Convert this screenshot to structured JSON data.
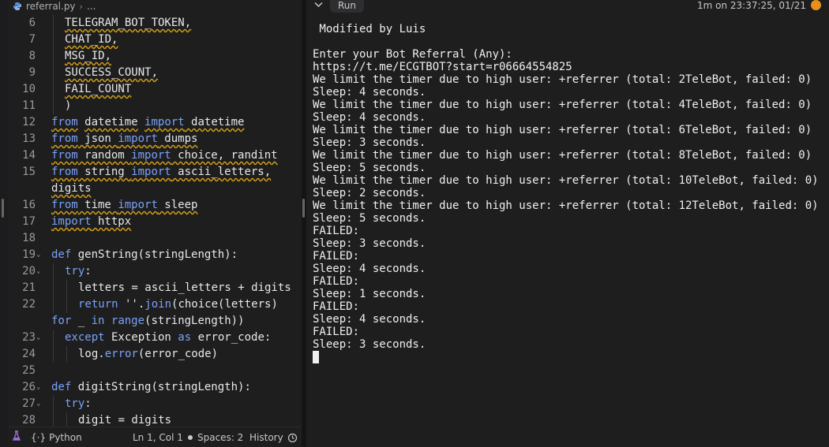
{
  "editor": {
    "filename": "referral.py",
    "breadcrumb_more": "...",
    "lines": [
      {
        "n": "6",
        "indent": 1,
        "segments": [
          {
            "t": "TELEGRAM_BOT_TOKEN,",
            "c": "sq"
          }
        ]
      },
      {
        "n": "7",
        "indent": 1,
        "segments": [
          {
            "t": "CHAT_ID,",
            "c": "sq"
          }
        ]
      },
      {
        "n": "8",
        "indent": 1,
        "segments": [
          {
            "t": "MSG_ID,",
            "c": "sq"
          }
        ]
      },
      {
        "n": "9",
        "indent": 1,
        "segments": [
          {
            "t": "SUCCESS_COUNT,",
            "c": "sq"
          }
        ]
      },
      {
        "n": "10",
        "indent": 1,
        "segments": [
          {
            "t": "FAIL_COUNT",
            "c": "sq"
          }
        ]
      },
      {
        "n": "11",
        "indent": 1,
        "segments": [
          {
            "t": ")",
            "c": ""
          }
        ]
      },
      {
        "n": "12",
        "indent": 0,
        "segments": [
          {
            "t": "from",
            "c": "kw sq"
          },
          {
            "t": " ",
            "c": ""
          },
          {
            "t": "datetime",
            "c": "sq"
          },
          {
            "t": " ",
            "c": ""
          },
          {
            "t": "import",
            "c": "kw sq"
          },
          {
            "t": " datetime",
            "c": "sq"
          }
        ]
      },
      {
        "n": "13",
        "indent": 0,
        "segments": [
          {
            "t": "from",
            "c": "kw sq"
          },
          {
            "t": " json ",
            "c": "sq"
          },
          {
            "t": "import",
            "c": "kw sq"
          },
          {
            "t": " dumps",
            "c": "sq"
          }
        ]
      },
      {
        "n": "14",
        "indent": 0,
        "segments": [
          {
            "t": "from",
            "c": "kw sq"
          },
          {
            "t": " random ",
            "c": "sq"
          },
          {
            "t": "import",
            "c": "kw sq"
          },
          {
            "t": " choice, randint",
            "c": "sq"
          }
        ]
      },
      {
        "n": "15",
        "indent": 0,
        "segments": [
          {
            "t": "from",
            "c": "kw sq"
          },
          {
            "t": " string ",
            "c": "sq"
          },
          {
            "t": "import",
            "c": "kw sq"
          },
          {
            "t": " ascii_letters,",
            "c": "sq"
          }
        ]
      },
      {
        "n": "",
        "indent": 0,
        "segments": [
          {
            "t": "digits",
            "c": "sq"
          }
        ]
      },
      {
        "n": "16",
        "indent": 0,
        "segments": [
          {
            "t": "from",
            "c": "kw sq"
          },
          {
            "t": " time ",
            "c": "sq"
          },
          {
            "t": "import",
            "c": "kw sq"
          },
          {
            "t": " sleep",
            "c": "sq"
          }
        ]
      },
      {
        "n": "17",
        "indent": 0,
        "segments": [
          {
            "t": "import",
            "c": "kw sq"
          },
          {
            "t": " httpx",
            "c": "sq"
          }
        ]
      },
      {
        "n": "18",
        "indent": 0,
        "segments": []
      },
      {
        "n": "19",
        "indent": 0,
        "fold": true,
        "segments": [
          {
            "t": "def",
            "c": "kw"
          },
          {
            "t": " genString(stringLength):",
            "c": ""
          }
        ]
      },
      {
        "n": "20",
        "indent": 1,
        "fold": true,
        "segments": [
          {
            "t": "try",
            "c": "kw"
          },
          {
            "t": ":",
            "c": ""
          }
        ]
      },
      {
        "n": "21",
        "indent": 2,
        "segments": [
          {
            "t": "letters = ascii_letters + digits",
            "c": ""
          }
        ]
      },
      {
        "n": "22",
        "indent": 2,
        "segments": [
          {
            "t": "return",
            "c": "kw"
          },
          {
            "t": " ''.",
            "c": ""
          },
          {
            "t": "join",
            "c": "kw"
          },
          {
            "t": "(choice(letters)",
            "c": ""
          }
        ]
      },
      {
        "n": "",
        "indent": 0,
        "segments": [
          {
            "t": "for",
            "c": "kw"
          },
          {
            "t": " _ ",
            "c": ""
          },
          {
            "t": "in",
            "c": "kw"
          },
          {
            "t": " ",
            "c": ""
          },
          {
            "t": "range",
            "c": "kw"
          },
          {
            "t": "(stringLength))",
            "c": ""
          }
        ]
      },
      {
        "n": "23",
        "indent": 1,
        "fold": true,
        "segments": [
          {
            "t": "except",
            "c": "kw"
          },
          {
            "t": " Exception ",
            "c": ""
          },
          {
            "t": "as",
            "c": "kw"
          },
          {
            "t": " error_code:",
            "c": ""
          }
        ]
      },
      {
        "n": "24",
        "indent": 2,
        "segments": [
          {
            "t": "log.",
            "c": ""
          },
          {
            "t": "error",
            "c": "kw"
          },
          {
            "t": "(error_code)",
            "c": ""
          }
        ]
      },
      {
        "n": "25",
        "indent": 0,
        "segments": []
      },
      {
        "n": "26",
        "indent": 0,
        "fold": true,
        "segments": [
          {
            "t": "def",
            "c": "kw"
          },
          {
            "t": " digitString(stringLength):",
            "c": ""
          }
        ]
      },
      {
        "n": "27",
        "indent": 1,
        "fold": true,
        "segments": [
          {
            "t": "try",
            "c": "kw"
          },
          {
            "t": ":",
            "c": ""
          }
        ]
      },
      {
        "n": "28",
        "indent": 2,
        "segments": [
          {
            "t": "digit = digits",
            "c": ""
          }
        ]
      }
    ]
  },
  "statusbar": {
    "language": "Python",
    "language_icon": "{·}",
    "position": "Ln 1, Col 1",
    "spaces": "Spaces: 2",
    "history": "History"
  },
  "console": {
    "run_label": "Run",
    "timestamp": "1m on 23:37:25, 01/21",
    "status_color": "#e8901a",
    "lines": [
      " Modified by Luis",
      "",
      "Enter your Bot Referral (Any):",
      "https://t.me/ECGTBOT?start=r06664554825",
      "We limit the timer due to high user: +referrer (total: 2TeleBot, failed: 0)",
      "Sleep: 4 seconds.",
      "We limit the timer due to high user: +referrer (total: 4TeleBot, failed: 0)",
      "Sleep: 4 seconds.",
      "We limit the timer due to high user: +referrer (total: 6TeleBot, failed: 0)",
      "Sleep: 3 seconds.",
      "We limit the timer due to high user: +referrer (total: 8TeleBot, failed: 0)",
      "Sleep: 5 seconds.",
      "We limit the timer due to high user: +referrer (total: 10TeleBot, failed: 0)",
      "Sleep: 2 seconds.",
      "We limit the timer due to high user: +referrer (total: 12TeleBot, failed: 0)",
      "Sleep: 5 seconds.",
      "FAILED:",
      "Sleep: 3 seconds.",
      "FAILED:",
      "Sleep: 4 seconds.",
      "FAILED:",
      "Sleep: 1 seconds.",
      "FAILED:",
      "Sleep: 4 seconds.",
      "FAILED:",
      "Sleep: 3 seconds."
    ]
  }
}
